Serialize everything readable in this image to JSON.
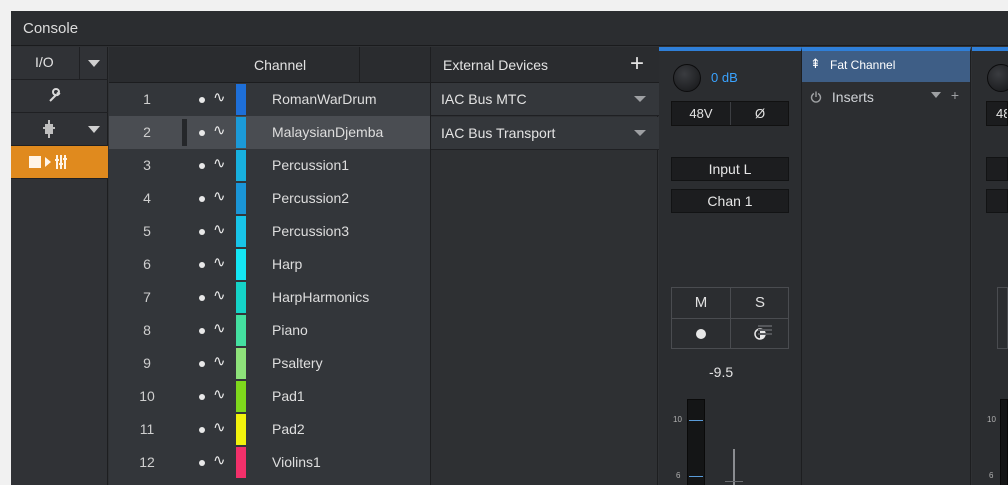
{
  "window": {
    "title": "Console"
  },
  "rail": {
    "io_label": "I/O",
    "items": [
      {
        "icon": "wrench-icon"
      },
      {
        "icon": "device-icon"
      },
      {
        "icon": "mixer-view-icon",
        "active": true
      }
    ]
  },
  "channel_list": {
    "header": "Channel",
    "rows": [
      {
        "num": "1",
        "name": "RomanWarDrum",
        "color": "#1e6fd8"
      },
      {
        "num": "2",
        "name": "MalaysianDjemba",
        "color": "#1b9ad8",
        "selected": true
      },
      {
        "num": "3",
        "name": "Percussion1",
        "color": "#17b0de"
      },
      {
        "num": "4",
        "name": "Percussion2",
        "color": "#1a95d6"
      },
      {
        "num": "5",
        "name": "Percussion3",
        "color": "#18c4e8"
      },
      {
        "num": "6",
        "name": "Harp",
        "color": "#14e6f4"
      },
      {
        "num": "7",
        "name": "HarpHarmonics",
        "color": "#15d4c8"
      },
      {
        "num": "8",
        "name": "Piano",
        "color": "#44e0a0"
      },
      {
        "num": "9",
        "name": "Psaltery",
        "color": "#8ee27a"
      },
      {
        "num": "10",
        "name": "Pad1",
        "color": "#7fd81c"
      },
      {
        "num": "11",
        "name": "Pad2",
        "color": "#f2f20d"
      },
      {
        "num": "12",
        "name": "Violins1",
        "color": "#f2306a"
      }
    ]
  },
  "external_devices": {
    "header": "External Devices",
    "add": "+",
    "items": [
      "IAC Bus MTC",
      "IAC Bus Transport"
    ]
  },
  "strip": {
    "gain": "0 dB",
    "phantom": "48V",
    "phase": "Ø",
    "input": "Input L",
    "channel": "Chan 1",
    "mute": "M",
    "solo": "S",
    "volume": "-9.5",
    "scale": [
      "10",
      "6"
    ]
  },
  "fat_channel": {
    "title": "Fat Channel",
    "inserts": "Inserts",
    "add": "+"
  },
  "partial_strip": {
    "phantom": "48",
    "scale": [
      "10",
      "6"
    ]
  }
}
